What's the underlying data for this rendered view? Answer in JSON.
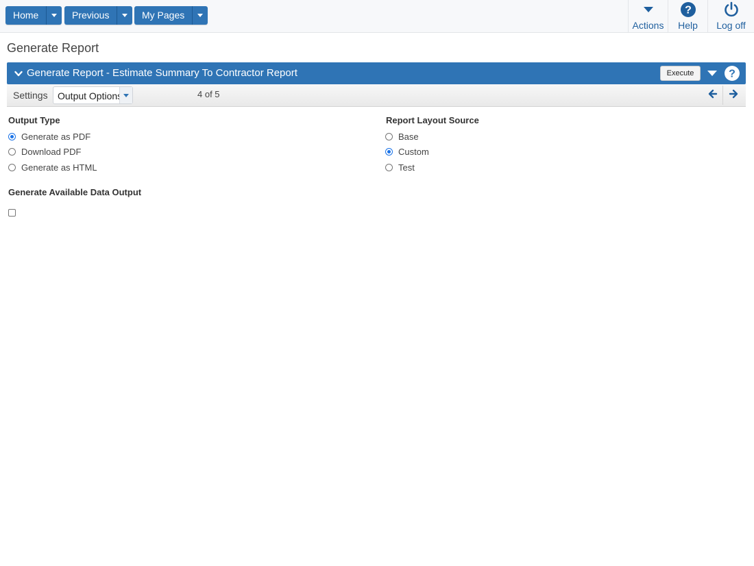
{
  "topbar": {
    "home_label": "Home",
    "previous_label": "Previous",
    "mypages_label": "My Pages",
    "actions_label": "Actions",
    "help_label": "Help",
    "logoff_label": "Log off"
  },
  "page": {
    "title": "Generate Report"
  },
  "panel": {
    "title": "Generate Report - Estimate Summary To Contractor Report",
    "execute_label": "Execute"
  },
  "settings": {
    "label": "Settings",
    "selected_option": "Output Options",
    "pager": "4 of 5"
  },
  "output_type": {
    "label": "Output Type",
    "options": [
      {
        "label": "Generate as PDF",
        "selected": true
      },
      {
        "label": "Download PDF",
        "selected": false
      },
      {
        "label": "Generate as HTML",
        "selected": false
      }
    ]
  },
  "layout_source": {
    "label": "Report Layout Source",
    "options": [
      {
        "label": "Base",
        "selected": false
      },
      {
        "label": "Custom",
        "selected": true
      },
      {
        "label": "Test",
        "selected": false
      }
    ]
  },
  "data_output": {
    "label": "Generate Available Data Output",
    "checked": false
  },
  "colors": {
    "brand": "#2f74b5",
    "link": "#1f5f9e"
  },
  "icons": [
    "caret-down-icon",
    "help-icon",
    "power-icon",
    "chevron-down-icon",
    "arrow-left-icon",
    "arrow-right-icon"
  ]
}
